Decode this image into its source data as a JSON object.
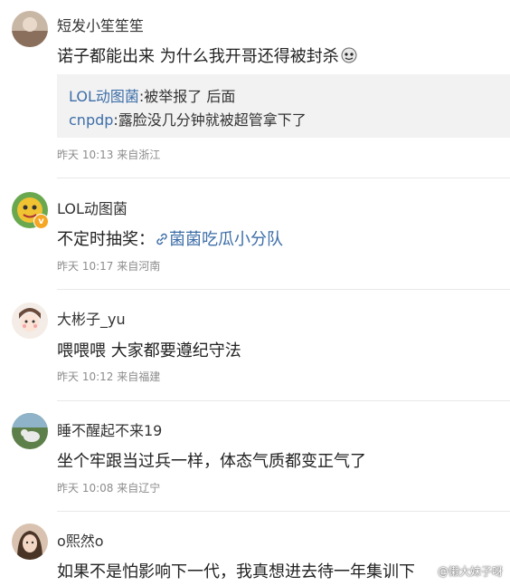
{
  "comments": [
    {
      "username": "短发小笙笙笙",
      "text": "诺子都能出来 为什么我开哥还得被封杀",
      "emoji_icon": "emoji-face-icon",
      "replies": [
        {
          "name": "LOL动图菌",
          "text": ":被举报了 后面"
        },
        {
          "name": "cnpdp",
          "text": ":露脸没几分钟就被超管拿下了"
        }
      ],
      "meta": "昨天 10:13 来自浙江"
    },
    {
      "username": "LOL动图菌",
      "text_prefix": "不定时抽奖：",
      "link_icon": "link-icon",
      "link_text": "菌菌吃瓜小分队",
      "verified_badge": "v",
      "meta": "昨天 10:17 来自河南"
    },
    {
      "username": "大彬子_yu",
      "text": "喂喂喂 大家都要遵纪守法",
      "meta": "昨天 10:12 来自福建"
    },
    {
      "username": "睡不醒起不来19",
      "text": "坐个牢跟当过兵一样，体态气质都变正气了",
      "meta": "昨天 10:08 来自辽宁"
    },
    {
      "username": "o熙然o",
      "text": "如果不是怕影响下一代，我真想进去待一年集训下"
    }
  ],
  "watermark": "@懒大妹子呀",
  "colors": {
    "link": "#3d6ea8",
    "meta": "#8c8c8c",
    "quote_bg": "#f2f2f2"
  }
}
